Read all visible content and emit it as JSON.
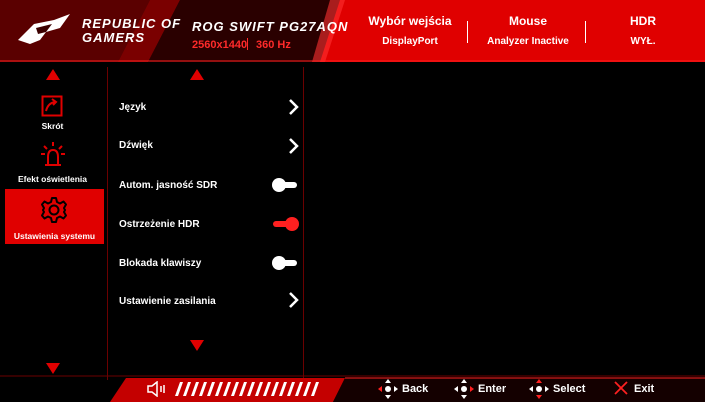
{
  "header": {
    "brand": {
      "line1": "REPUBLIC OF",
      "line2": "GAMERS"
    },
    "model": {
      "name": "ROG SWIFT PG27AQN",
      "resolution": "2560x1440",
      "refresh": "360 Hz"
    },
    "status": [
      {
        "title": "Wybór wejścia",
        "value": "DisplayPort"
      },
      {
        "title": "Mouse",
        "value": "Analyzer Inactive"
      },
      {
        "title": "HDR",
        "value": "WYŁ."
      }
    ]
  },
  "sidebar": {
    "items": [
      {
        "label": "Skrót",
        "icon": "shortcut-icon"
      },
      {
        "label": "Efekt oświetlenia",
        "icon": "lighting-icon"
      },
      {
        "label": "Ustawienia systemu",
        "icon": "settings-gear-icon",
        "selected": true
      }
    ]
  },
  "settings": {
    "items": [
      {
        "label": "Język",
        "control": "chevron-right-icon"
      },
      {
        "label": "Dźwięk",
        "control": "chevron-right-icon"
      },
      {
        "label": "Autom. jasność SDR",
        "control": "toggle",
        "state": "off"
      },
      {
        "label": "Ostrzeżenie HDR",
        "control": "toggle",
        "state": "on"
      },
      {
        "label": "Blokada klawiszy",
        "control": "toggle",
        "state": "off"
      },
      {
        "label": "Ustawienie zasilania",
        "control": "chevron-right-icon"
      }
    ]
  },
  "footer": {
    "volume_icon": "speaker-icon",
    "nav": [
      {
        "label": "Back",
        "icon": "joystick-left-icon"
      },
      {
        "label": "Enter",
        "icon": "joystick-right-icon"
      },
      {
        "label": "Select",
        "icon": "joystick-updown-icon"
      },
      {
        "label": "Exit",
        "icon": "close-icon"
      }
    ]
  },
  "colors": {
    "accent": "#e00000",
    "header_bg": "#3c0000",
    "divider": "#6b0000",
    "toggle_on": "#ff2020"
  }
}
